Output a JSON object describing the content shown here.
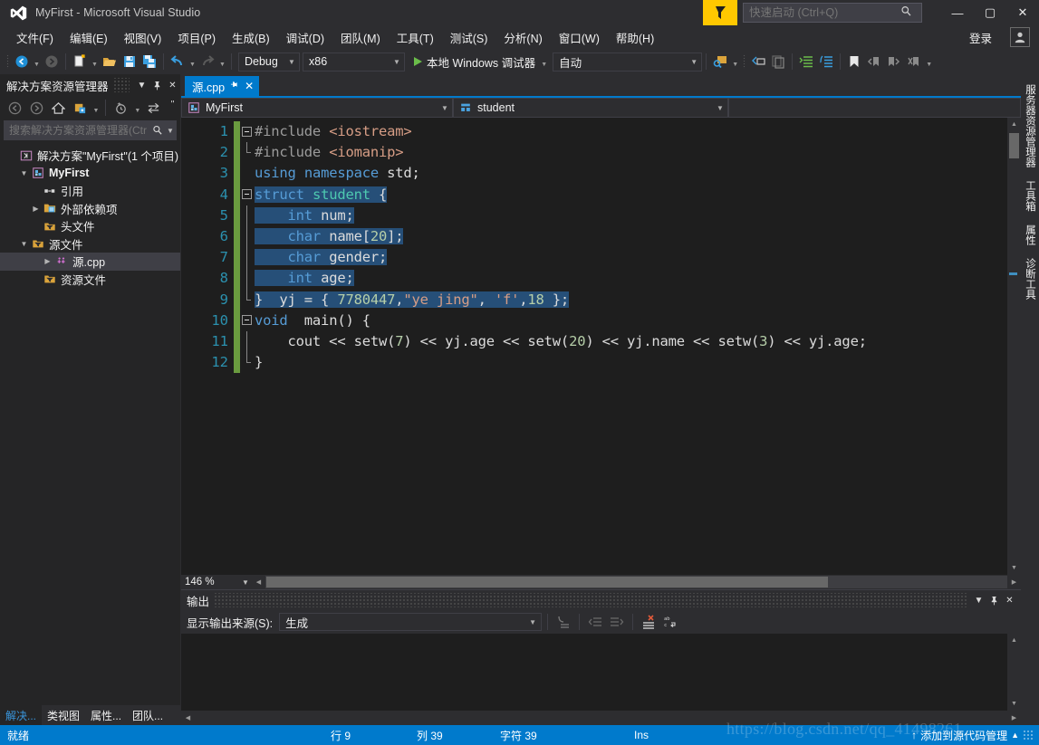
{
  "window": {
    "title": "MyFirst - Microsoft Visual Studio",
    "minimize": "—",
    "maximize": "▢",
    "close": "✕"
  },
  "quick_launch": {
    "placeholder": "快速启动 (Ctrl+Q)",
    "value": "",
    "search_icon": "search-icon"
  },
  "menu": {
    "items": [
      {
        "label": "文件(F)",
        "key": "F"
      },
      {
        "label": "编辑(E)",
        "key": "E"
      },
      {
        "label": "视图(V)",
        "key": "V"
      },
      {
        "label": "项目(P)",
        "key": "P"
      },
      {
        "label": "生成(B)",
        "key": "B"
      },
      {
        "label": "调试(D)",
        "key": "D"
      },
      {
        "label": "团队(M)",
        "key": "M"
      },
      {
        "label": "工具(T)",
        "key": "T"
      },
      {
        "label": "测试(S)",
        "key": "S"
      },
      {
        "label": "分析(N)",
        "key": "N"
      },
      {
        "label": "窗口(W)",
        "key": "W"
      },
      {
        "label": "帮助(H)",
        "key": "H"
      }
    ],
    "signin": "登录"
  },
  "toolbar": {
    "config": "Debug",
    "platform": "x86",
    "run_label": "本地 Windows 调试器",
    "auto": "自动"
  },
  "solution_explorer": {
    "title": "解决方案资源管理器",
    "search_placeholder": "搜索解决方案资源管理器(Ctr",
    "tree": [
      {
        "label": "解决方案\"MyFirst\"(1 个项目)",
        "indent": 0,
        "icon": "solution-icon",
        "expander": "",
        "bold": false,
        "selected": false
      },
      {
        "label": "MyFirst",
        "indent": 1,
        "icon": "project-icon",
        "expander": "▼",
        "bold": true,
        "selected": false
      },
      {
        "label": "引用",
        "indent": 2,
        "icon": "references-icon",
        "expander": "",
        "bold": false,
        "selected": false
      },
      {
        "label": "外部依赖项",
        "indent": 2,
        "icon": "folder-ext-icon",
        "expander": "▶",
        "bold": false,
        "selected": false
      },
      {
        "label": "头文件",
        "indent": 2,
        "icon": "folder-filter-icon",
        "expander": "",
        "bold": false,
        "selected": false
      },
      {
        "label": "源文件",
        "indent": 2,
        "icon": "folder-filter-icon",
        "expander": "▼",
        "bold": false,
        "selected": false
      },
      {
        "label": "源.cpp",
        "indent": 3,
        "icon": "cpp-file-icon",
        "expander": "▶",
        "bold": false,
        "selected": true
      },
      {
        "label": "资源文件",
        "indent": 2,
        "icon": "folder-filter-icon",
        "expander": "",
        "bold": false,
        "selected": false
      }
    ],
    "bottom_tabs": [
      {
        "label": "解决...",
        "active": true
      },
      {
        "label": "类视图",
        "active": false
      },
      {
        "label": "属性...",
        "active": false
      },
      {
        "label": "团队...",
        "active": false
      }
    ]
  },
  "editor": {
    "tab": {
      "label": "源.cpp",
      "pin": "pin-icon",
      "close": "✕"
    },
    "navbar": {
      "scope": "MyFirst",
      "member": "student"
    },
    "zoom": "146 %",
    "lines": [
      {
        "n": "1",
        "fold": "start",
        "modified": true,
        "tokens": [
          {
            "t": "#include ",
            "c": "pp"
          },
          {
            "t": "<iostream>",
            "c": "inc"
          }
        ]
      },
      {
        "n": "2",
        "fold": "end",
        "modified": true,
        "tokens": [
          {
            "t": "#include ",
            "c": "pp"
          },
          {
            "t": "<iomanip>",
            "c": "inc"
          }
        ]
      },
      {
        "n": "3",
        "fold": "none",
        "modified": true,
        "tokens": [
          {
            "t": "using",
            "c": "k"
          },
          {
            "t": " ",
            "c": "pl"
          },
          {
            "t": "namespace",
            "c": "k"
          },
          {
            "t": " std;",
            "c": "pl"
          }
        ]
      },
      {
        "n": "4",
        "fold": "start",
        "modified": true,
        "tokens": [
          {
            "t": "struct",
            "c": "k sel"
          },
          {
            "t": " ",
            "c": "pl sel"
          },
          {
            "t": "student",
            "c": "kt sel"
          },
          {
            "t": " {",
            "c": "pl sel"
          }
        ]
      },
      {
        "n": "5",
        "fold": "bar",
        "modified": true,
        "tokens": [
          {
            "t": "    ",
            "c": "pl sel"
          },
          {
            "t": "int",
            "c": "k sel"
          },
          {
            "t": " num;",
            "c": "pl sel"
          }
        ]
      },
      {
        "n": "6",
        "fold": "bar",
        "modified": true,
        "tokens": [
          {
            "t": "    ",
            "c": "pl sel"
          },
          {
            "t": "char",
            "c": "k sel"
          },
          {
            "t": " name",
            "c": "pl sel"
          },
          {
            "t": "[",
            "c": "pl sel"
          },
          {
            "t": "20",
            "c": "num sel"
          },
          {
            "t": "];",
            "c": "pl sel"
          }
        ]
      },
      {
        "n": "7",
        "fold": "bar",
        "modified": true,
        "tokens": [
          {
            "t": "    ",
            "c": "pl sel"
          },
          {
            "t": "char",
            "c": "k sel"
          },
          {
            "t": " gender;",
            "c": "pl sel"
          }
        ]
      },
      {
        "n": "8",
        "fold": "bar",
        "modified": true,
        "tokens": [
          {
            "t": "    ",
            "c": "pl sel"
          },
          {
            "t": "int",
            "c": "k sel"
          },
          {
            "t": " age;",
            "c": "pl sel"
          }
        ]
      },
      {
        "n": "9",
        "fold": "close",
        "modified": true,
        "tokens": [
          {
            "t": "} ",
            "c": "pl sel"
          },
          {
            "t": " yj = { ",
            "c": "pl sel"
          },
          {
            "t": "7780447",
            "c": "num sel"
          },
          {
            "t": ",",
            "c": "pl sel"
          },
          {
            "t": "\"ye jing\"",
            "c": "str sel"
          },
          {
            "t": ", ",
            "c": "pl sel"
          },
          {
            "t": "'f'",
            "c": "str sel"
          },
          {
            "t": ",",
            "c": "pl sel"
          },
          {
            "t": "18",
            "c": "num sel"
          },
          {
            "t": " };",
            "c": "pl sel"
          }
        ]
      },
      {
        "n": "10",
        "fold": "start",
        "modified": true,
        "tokens": [
          {
            "t": "void",
            "c": "k"
          },
          {
            "t": "  ",
            "c": "pl"
          },
          {
            "t": "main",
            "c": "fn"
          },
          {
            "t": "() {",
            "c": "pl"
          }
        ]
      },
      {
        "n": "11",
        "fold": "bar",
        "modified": true,
        "tokens": [
          {
            "t": "    cout << ",
            "c": "pl"
          },
          {
            "t": "setw",
            "c": "pl"
          },
          {
            "t": "(",
            "c": "pl"
          },
          {
            "t": "7",
            "c": "num"
          },
          {
            "t": ") << yj.age << ",
            "c": "pl"
          },
          {
            "t": "setw",
            "c": "pl"
          },
          {
            "t": "(",
            "c": "pl"
          },
          {
            "t": "20",
            "c": "num"
          },
          {
            "t": ") << yj.name << ",
            "c": "pl"
          },
          {
            "t": "setw",
            "c": "pl"
          },
          {
            "t": "(",
            "c": "pl"
          },
          {
            "t": "3",
            "c": "num"
          },
          {
            "t": ") << yj.age;",
            "c": "pl"
          }
        ]
      },
      {
        "n": "12",
        "fold": "close",
        "modified": true,
        "tokens": [
          {
            "t": "}",
            "c": "pl"
          }
        ]
      }
    ]
  },
  "output_panel": {
    "title": "输出",
    "source_label": "显示输出来源(S):",
    "source_value": "生成",
    "content": ""
  },
  "right_tabs": [
    {
      "label": "服务器资源管理器"
    },
    {
      "label": "工具箱"
    },
    {
      "label": "属性"
    },
    {
      "label": "诊断工具"
    }
  ],
  "status_bar": {
    "ready": "就绪",
    "line_label": "行 9",
    "col_label": "列 39",
    "char_label": "字符 39",
    "insert_mode": "Ins",
    "source_control": "添加到源代码管理",
    "up_arrow": "↑",
    "caret": "▲"
  },
  "watermark": "https://blog.csdn.net/qq_41498261",
  "colors": {
    "accent": "#007acc",
    "chrome": "#2d2d30",
    "panel": "#252526",
    "editor_bg": "#1e1e1e",
    "selection": "#264f78",
    "linenumber": "#2b91af",
    "flag_yellow": "#ffc800",
    "modified_marker": "#6a9b3f"
  }
}
